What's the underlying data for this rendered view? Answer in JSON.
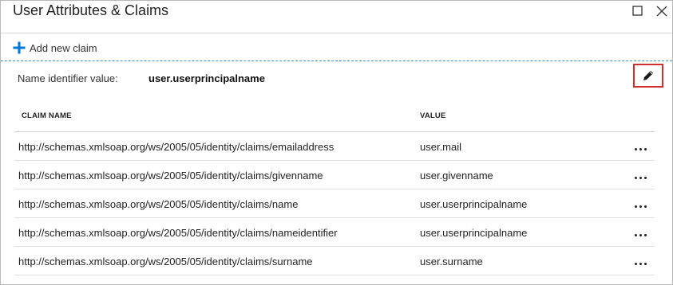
{
  "window": {
    "title": "User Attributes & Claims",
    "icons": {
      "maximize": "maximize-icon",
      "close": "close-icon"
    }
  },
  "toolbar": {
    "add_label": "Add new claim",
    "add_icon": "plus-icon",
    "accent_color": "#0078d4"
  },
  "name_identifier": {
    "label": "Name identifier value:",
    "value": "user.userprincipalname",
    "edit_icon": "pencil-icon",
    "highlight_color": "#d32f2f"
  },
  "table": {
    "headers": {
      "claim_name": "CLAIM NAME",
      "value": "VALUE"
    },
    "rows": [
      {
        "claim_name": "http://schemas.xmlsoap.org/ws/2005/05/identity/claims/emailaddress",
        "value": "user.mail",
        "more": "..."
      },
      {
        "claim_name": "http://schemas.xmlsoap.org/ws/2005/05/identity/claims/givenname",
        "value": "user.givenname",
        "more": "..."
      },
      {
        "claim_name": "http://schemas.xmlsoap.org/ws/2005/05/identity/claims/name",
        "value": "user.userprincipalname",
        "more": "..."
      },
      {
        "claim_name": "http://schemas.xmlsoap.org/ws/2005/05/identity/claims/nameidentifier",
        "value": "user.userprincipalname",
        "more": "..."
      },
      {
        "claim_name": "http://schemas.xmlsoap.org/ws/2005/05/identity/claims/surname",
        "value": "user.surname",
        "more": "..."
      }
    ]
  }
}
